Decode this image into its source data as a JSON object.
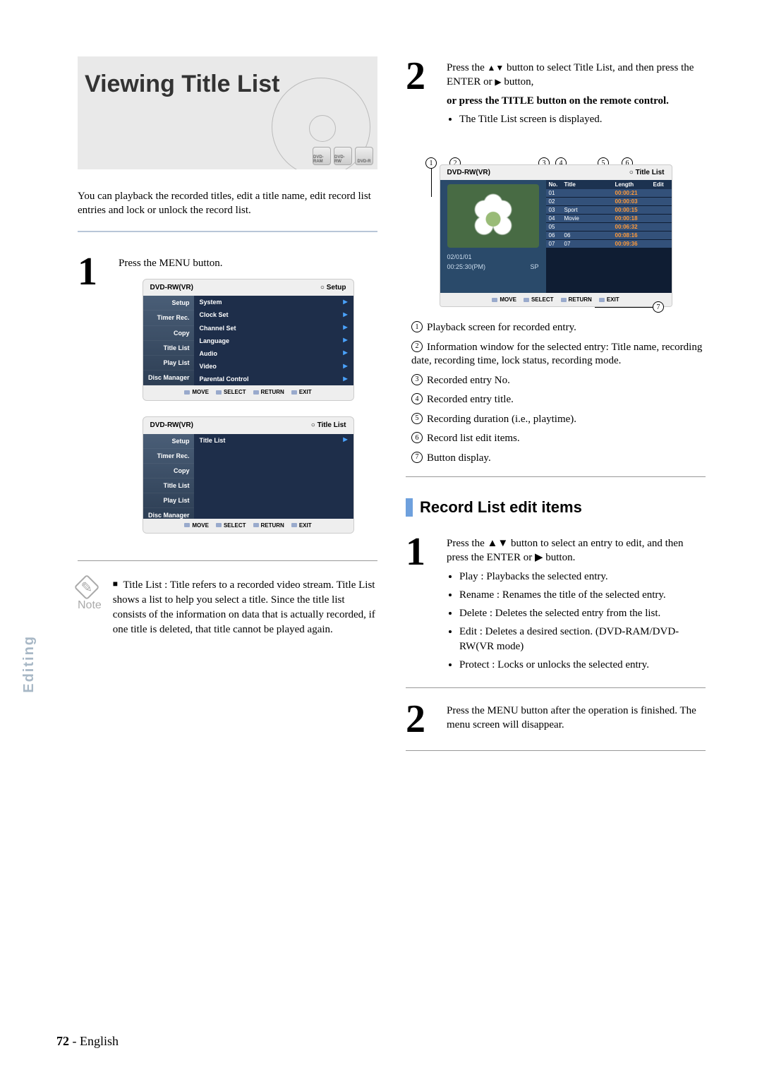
{
  "banner": {
    "title": "Viewing Title List",
    "badges": [
      "DVD-RAM",
      "DVD-RW",
      "DVD-R"
    ]
  },
  "intro": "You can playback the recorded titles, edit a title name, edit record list entries and lock or unlock the record list.",
  "leftStep1": "Press the MENU button.",
  "menuShot1": {
    "headerLeft": "DVD-RW(VR)",
    "headerRight": "Setup",
    "side": [
      "Setup",
      "Timer Rec.",
      "Copy",
      "Title List",
      "Play List",
      "Disc Manager"
    ],
    "list": [
      "System",
      "Clock Set",
      "Channel Set",
      "Language",
      "Audio",
      "Video",
      "Parental Control"
    ],
    "foot": [
      "MOVE",
      "SELECT",
      "RETURN",
      "EXIT"
    ]
  },
  "menuShot2": {
    "headerLeft": "DVD-RW(VR)",
    "headerRight": "Title List",
    "side": [
      "Setup",
      "Timer Rec.",
      "Copy",
      "Title List",
      "Play List",
      "Disc Manager"
    ],
    "list": [
      "Title List"
    ],
    "foot": [
      "MOVE",
      "SELECT",
      "RETURN",
      "EXIT"
    ]
  },
  "note": {
    "label": "Note",
    "heading": "Title List :",
    "text": "Title refers to a recorded video stream. Title List shows a list to help you select a title. Since the title list consists of the information on data that is actually recorded, if one title is deleted, that title cannot be played again."
  },
  "rightStep2": {
    "line1a": "Press the ",
    "line1b": " button to select Title List, and then press the ENTER or ",
    "line1c": " button,",
    "bold": "or press the TITLE button on the remote control.",
    "bullet": "The Title List screen is displayed."
  },
  "tlShot": {
    "headerLeft": "DVD-RW(VR)",
    "headerRight": "Title List",
    "date": "02/01/01",
    "time": "00:25:30(PM)",
    "sp": "SP",
    "cols": [
      "No.",
      "Title",
      "Length",
      "Edit"
    ],
    "rows": [
      {
        "no": "01",
        "title": "",
        "len": "00:00:21"
      },
      {
        "no": "02",
        "title": "",
        "len": "00:00:03"
      },
      {
        "no": "03",
        "title": "Sport",
        "len": "00:00:15"
      },
      {
        "no": "04",
        "title": "Movie",
        "len": "00:00:18"
      },
      {
        "no": "05",
        "title": "",
        "len": "00:06:32"
      },
      {
        "no": "06",
        "title": "06",
        "len": "00:08:16"
      },
      {
        "no": "07",
        "title": "07",
        "len": "00:09:36"
      }
    ],
    "foot": [
      "MOVE",
      "SELECT",
      "RETURN",
      "EXIT"
    ]
  },
  "legend": [
    "Playback screen for recorded entry.",
    "Information window for the selected entry: Title name, recording date, recording time, lock status, recording mode.",
    "Recorded entry No.",
    "Recorded entry title.",
    "Recording duration (i.e., playtime).",
    "Record list edit items.",
    "Button display."
  ],
  "section": {
    "title": "Record List edit items"
  },
  "recStep1": {
    "lead": "Press the ▲▼ button to select an entry to edit, and then press the ENTER or ▶ button.",
    "bullets": [
      "Play : Playbacks the selected entry.",
      "Rename : Renames the title of the selected entry.",
      "Delete : Deletes the selected entry from the list.",
      "Edit : Deletes a desired section. (DVD-RAM/DVD-RW(VR mode)",
      "Protect : Locks or unlocks the selected entry."
    ]
  },
  "recStep2": "Press the MENU button after the operation is finished. The menu screen will disappear.",
  "sideTab": "Editing",
  "footer": {
    "page": "72",
    "lang": "English"
  }
}
